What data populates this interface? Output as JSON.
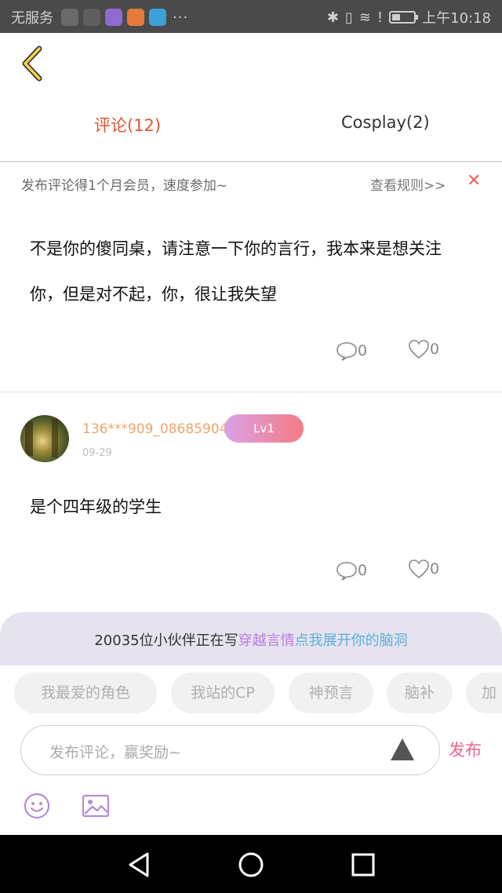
{
  "status_bar": {
    "carrier": "无服务",
    "more": "···",
    "time": "上午10:18",
    "battery_level": 0.4,
    "app_icon_colors": [
      "#5b5b5b",
      "#6a6a6a",
      "#8f6bd0",
      "#e57a3a",
      "#3aa2d8"
    ]
  },
  "header": {
    "back_icon": "chevron-left-icon",
    "accent": "#f2d24b"
  },
  "tabs": [
    {
      "label": "评论(12)",
      "active": true,
      "color": "#e25533"
    },
    {
      "label": "Cosplay(2)",
      "active": false
    }
  ],
  "notice": {
    "text": "发布评论得1个月会员，速度参加~",
    "rules_link": "查看规则>>",
    "close_icon": "✕",
    "close_color": "#f0635a"
  },
  "comments": [
    {
      "text": "不是你的傻同桌，请注意一下你的言行，我本来是想关注你，但是对不起，你，很让我失望",
      "reply_count": "0",
      "like_count": "0"
    },
    {
      "username": "136***909_0868590486",
      "level": "Lv1",
      "date": "09-29",
      "text": "是个四年级的学生",
      "reply_count": "0",
      "like_count": "0"
    }
  ],
  "banner": {
    "prefix": "20035位小伙伴正在写",
    "highlight": "穿越言情",
    "cta": "点我展开你的脑洞"
  },
  "chips": [
    "我最爱的角色",
    "我站的CP",
    "神预言",
    "脑补",
    "加"
  ],
  "composer": {
    "placeholder": "发布评论，赢奖励~",
    "publish_label": "发布",
    "publish_color": "#f0638b"
  },
  "toolbar_icons": [
    "emoji-icon",
    "image-icon"
  ],
  "nav_icons": [
    "back-icon",
    "home-icon",
    "recents-icon"
  ]
}
